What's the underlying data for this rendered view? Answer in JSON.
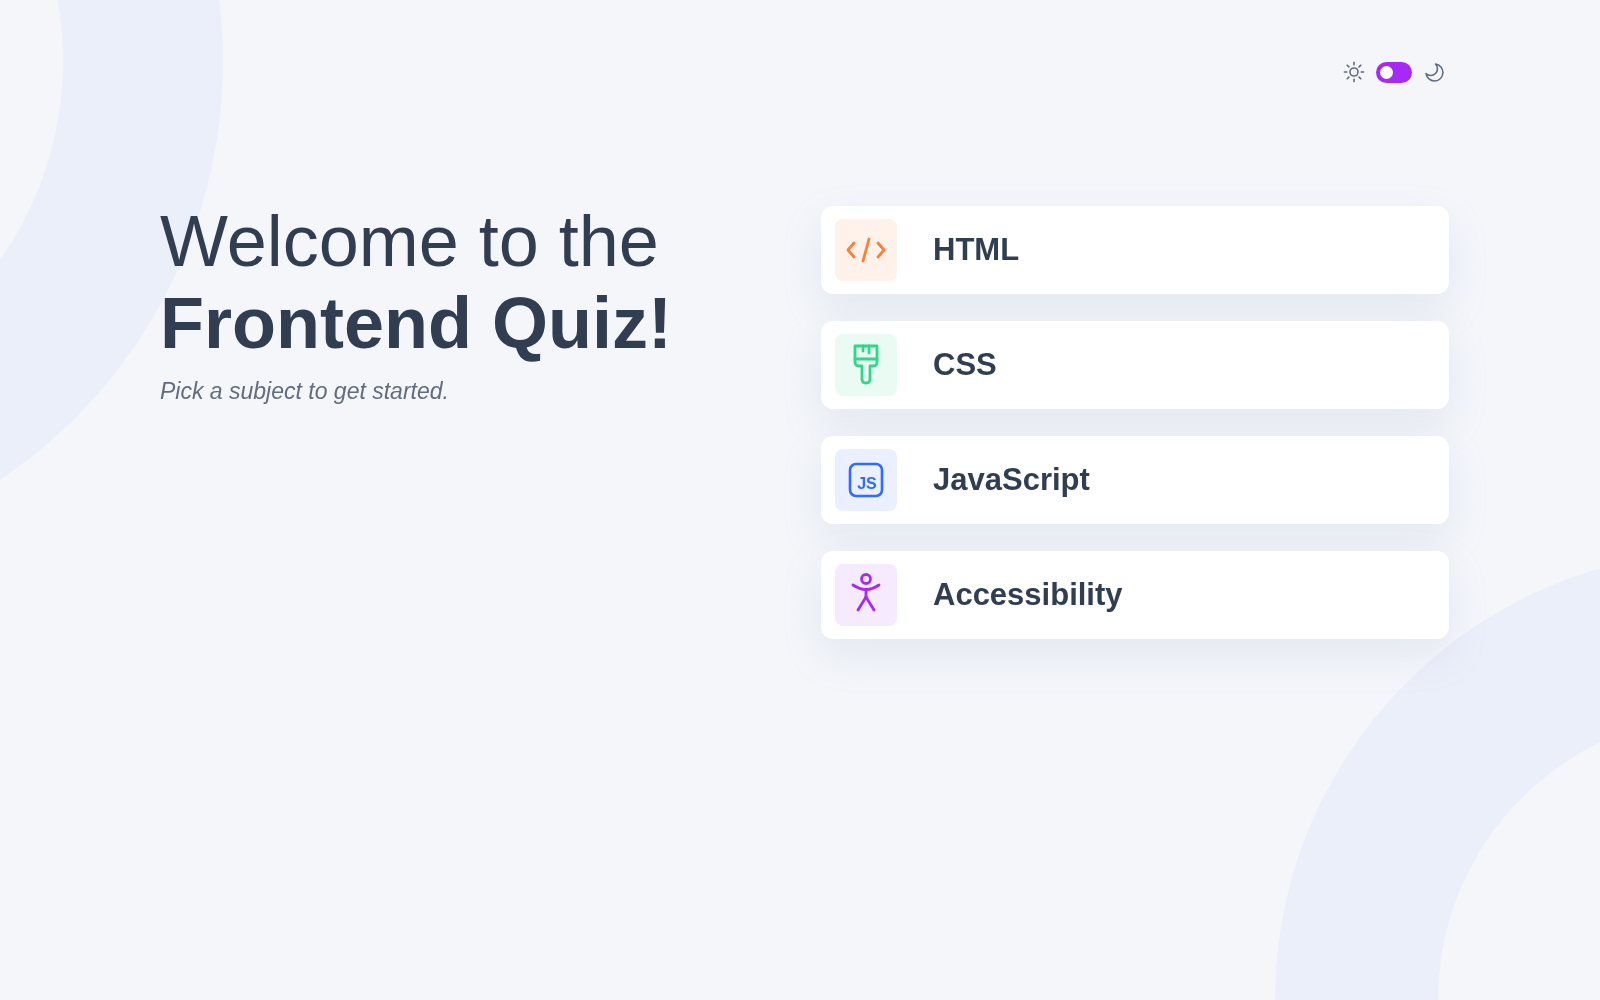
{
  "theme_toggle": {
    "on": false
  },
  "heading": "Welcome to the **Frontend Quiz!**",
  "subtitle": "Pick a subject to get started.",
  "subjects": [
    {
      "label": "HTML",
      "kind": "code",
      "color": "#ff7e35"
    },
    {
      "label": "CSS",
      "kind": "brush",
      "color": "#2fd887"
    },
    {
      "label": "JavaScript",
      "kind": "letters",
      "icon_text": "JS",
      "color": "#306aff"
    },
    {
      "label": "Accessibility",
      "kind": "person",
      "color": "#a729f5"
    }
  ]
}
